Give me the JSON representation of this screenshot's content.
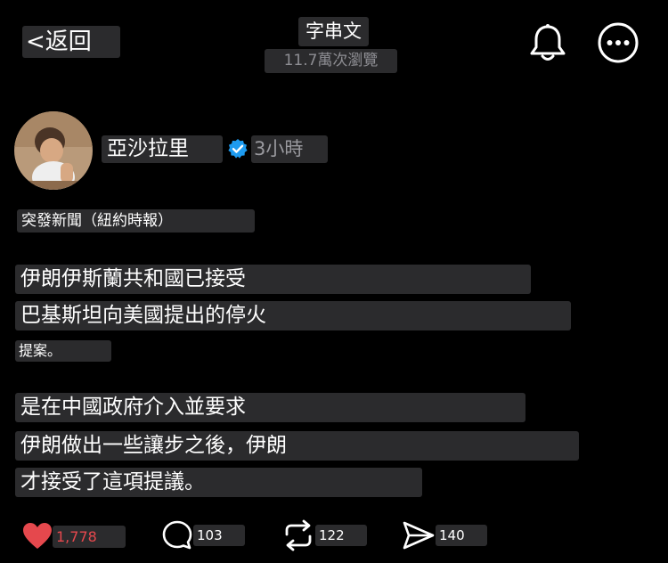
{
  "header": {
    "back_label": "<返回",
    "title": "字串文",
    "views": "11.7萬次瀏覽"
  },
  "icons": {
    "bell": "bell-icon",
    "more": "more-options-icon",
    "verified": "verified-badge-icon",
    "heart": "heart-icon",
    "comment": "comment-icon",
    "repost": "repost-icon",
    "share": "send-icon"
  },
  "post": {
    "username": "亞沙拉里",
    "time": "3小時",
    "tag": "突發新聞（紐約時報）",
    "lines": [
      "伊朗伊斯蘭共和國已接受",
      "巴基斯坦向美國提出的停火",
      "提案。",
      "是在中國政府介入並要求",
      "伊朗做出一些讓步之後，伊朗",
      "才接受了這項提議。"
    ]
  },
  "actions": {
    "likes": "1,778",
    "comments": "103",
    "reposts": "122",
    "shares": "140"
  },
  "colors": {
    "background": "#000000",
    "chip": "#2b2b2d",
    "like": "#e5484d",
    "verified": "#1d9bf0",
    "muted": "#8e8e93"
  }
}
